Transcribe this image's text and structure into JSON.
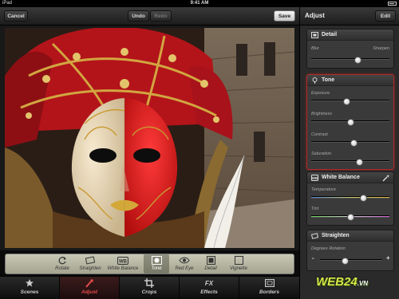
{
  "status": {
    "carrier": "iPad",
    "time": "9:41 AM"
  },
  "toolbar": {
    "cancel": "Cancel",
    "undo": "Undo",
    "redo": "Redo",
    "save": "Save"
  },
  "panel": {
    "title": "Adjust",
    "edit": "Edit",
    "detail": {
      "title": "Detail",
      "left": "Blur",
      "right": "Sharpen",
      "value": 0.6
    },
    "tone": {
      "title": "Tone",
      "sliders": [
        {
          "label": "Exposure",
          "value": 0.45
        },
        {
          "label": "Brightness",
          "value": 0.5
        },
        {
          "label": "Contrast",
          "value": 0.55
        },
        {
          "label": "Saturation",
          "value": 0.62
        }
      ]
    },
    "white_balance": {
      "title": "White Balance",
      "sliders": [
        {
          "label": "Temperature",
          "value": 0.67
        },
        {
          "label": "Tint",
          "value": 0.5
        }
      ]
    },
    "straighten": {
      "title": "Straighten",
      "label": "Degrees Rotation",
      "minus": "-",
      "plus": "+",
      "value": 0.41
    }
  },
  "tools": [
    {
      "label": "Rotate",
      "icon": "rotate-icon"
    },
    {
      "label": "Straighten",
      "icon": "straighten-icon"
    },
    {
      "label": "White Balance",
      "icon": "wb-icon"
    },
    {
      "label": "Tone",
      "icon": "tone-icon",
      "active": true
    },
    {
      "label": "Red Eye",
      "icon": "eye-icon"
    },
    {
      "label": "Detail",
      "icon": "detail-icon"
    },
    {
      "label": "Vignette",
      "icon": "vignette-icon"
    }
  ],
  "tabs": [
    {
      "label": "Scenes",
      "icon": "scenes-icon"
    },
    {
      "label": "Adjust",
      "icon": "adjust-icon",
      "active": true
    },
    {
      "label": "Crops",
      "icon": "crops-icon"
    },
    {
      "label": "Effects",
      "icon": "fx-icon",
      "glyph": "FX"
    },
    {
      "label": "Borders",
      "icon": "borders-icon"
    }
  ],
  "watermark": {
    "main": "WEB24",
    "suffix": ".VN"
  },
  "colors": {
    "accent": "#e84a4a",
    "panel": "#2a2a2a",
    "tool_strip": "#b8b8a4"
  }
}
